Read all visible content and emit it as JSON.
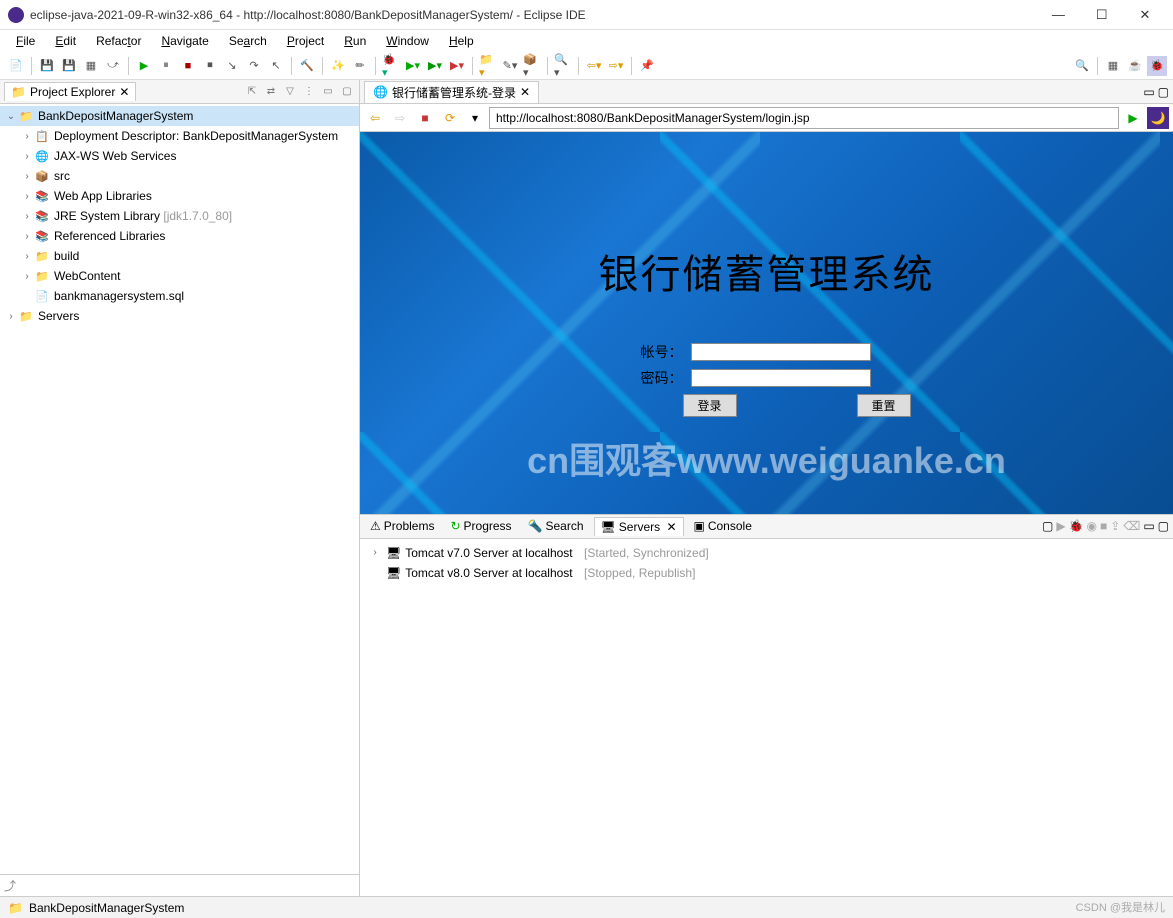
{
  "window": {
    "title": "eclipse-java-2021-09-R-win32-x86_64 - http://localhost:8080/BankDepositManagerSystem/ - Eclipse IDE"
  },
  "menus": [
    "File",
    "Edit",
    "Refactor",
    "Navigate",
    "Search",
    "Project",
    "Run",
    "Window",
    "Help"
  ],
  "explorer": {
    "title": "Project Explorer",
    "root": "BankDepositManagerSystem",
    "items": [
      "Deployment Descriptor: BankDepositManagerSystem",
      "JAX-WS Web Services",
      "src",
      "Web App Libraries",
      "JRE System Library",
      "Referenced Libraries",
      "build",
      "WebContent",
      "bankmanagersystem.sql"
    ],
    "jre_hint": "[jdk1.7.0_80]",
    "servers": "Servers"
  },
  "editor": {
    "tab": "银行储蓄管理系统-登录",
    "url": "http://localhost:8080/BankDepositManagerSystem/login.jsp",
    "page_title": "银行储蓄管理系统",
    "label_account": "帐号：",
    "label_password": "密码：",
    "btn_login": "登录",
    "btn_reset": "重置"
  },
  "bottom": {
    "tabs": [
      "Problems",
      "Progress",
      "Search",
      "Servers",
      "Console"
    ],
    "server1_name": "Tomcat v7.0 Server at localhost",
    "server1_status": "[Started, Synchronized]",
    "server2_name": "Tomcat v8.0 Server at localhost",
    "server2_status": "[Stopped, Republish]"
  },
  "status": {
    "project": "BankDepositManagerSystem"
  },
  "watermark": "cn围观客www.weiguanke.cn",
  "csdn": "CSDN @我是林儿"
}
